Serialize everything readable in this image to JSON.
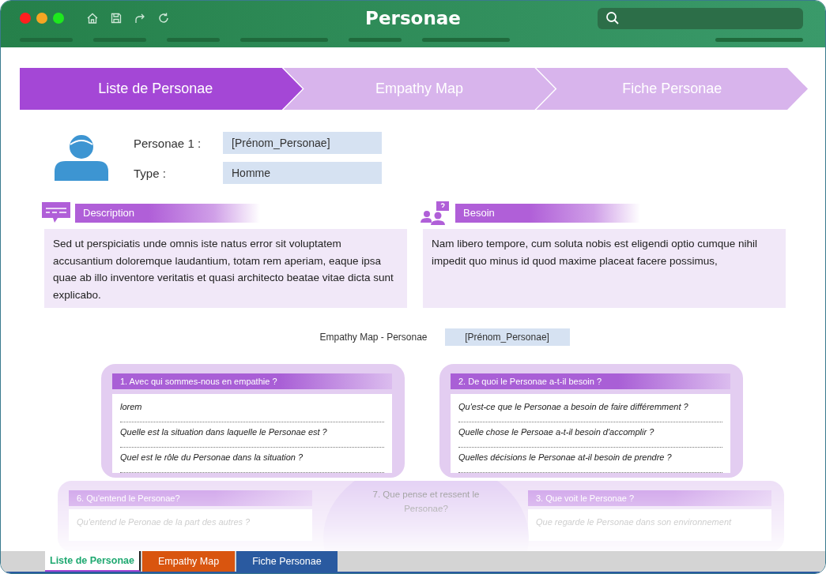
{
  "window": {
    "title": "Personae"
  },
  "steps": [
    {
      "label": "Liste de Personae",
      "selected": true
    },
    {
      "label": "Empathy Map",
      "selected": false
    },
    {
      "label": "Fiche Personae",
      "selected": false
    }
  ],
  "persona": {
    "fields": [
      {
        "label": "Personae 1 :",
        "value": "[Prénom_Personae]"
      },
      {
        "label": "Type :",
        "value": "Homme"
      }
    ]
  },
  "sections": [
    {
      "kind": "description",
      "title": "Description",
      "text": "Sed ut perspiciatis unde omnis iste natus error sit voluptatem accusantium doloremque laudantium, totam rem aperiam, eaque ipsa quae ab illo inventore veritatis et quasi architecto beatae vitae dicta sunt explicabo."
    },
    {
      "kind": "need",
      "title": "Besoin",
      "text": "Nam libero tempore, cum soluta nobis est eligendi optio cumque nihil impedit quo minus id quod maxime placeat facere possimus,"
    }
  ],
  "empathy_map": {
    "label": "Empathy Map - Personae",
    "value": "[Prénom_Personae]",
    "cards": [
      {
        "title": "1. Avec qui sommes-nous en empathie ?",
        "questions": [
          "lorem",
          "Quelle est la situation dans laquelle le Personae est ?",
          "Quel est le rôle du Personae dans la situation ?"
        ]
      },
      {
        "title": "2. De quoi le Personae a-t-il besoin ?",
        "questions": [
          "Qu'est-ce que le Personae a besoin de faire différemment ?",
          "Quelle chose le Persoae a-t-il besoin d'accomplir ?",
          "Quelles décisions le Personae at-il besoin de prendre ?"
        ]
      }
    ],
    "lower_cards": [
      {
        "title": "6. Qu'entend le Personae?",
        "questions": [
          "Qu'entend le Peronae de la part des autres ?"
        ]
      },
      {
        "title": "3. Que voit le Personae ?",
        "questions": [
          "Que regarde le Personae dans son environnement"
        ]
      }
    ],
    "center": "7. Que pense et ressent le Personae?"
  },
  "sheet_tabs": [
    {
      "label": "Liste de Personae",
      "selected": true,
      "color": "#1fa971"
    },
    {
      "label": "Empathy Map",
      "selected": false,
      "color": "#d9550f"
    },
    {
      "label": "Fiche Personae",
      "selected": false,
      "color": "#2a5aa0"
    }
  ]
}
